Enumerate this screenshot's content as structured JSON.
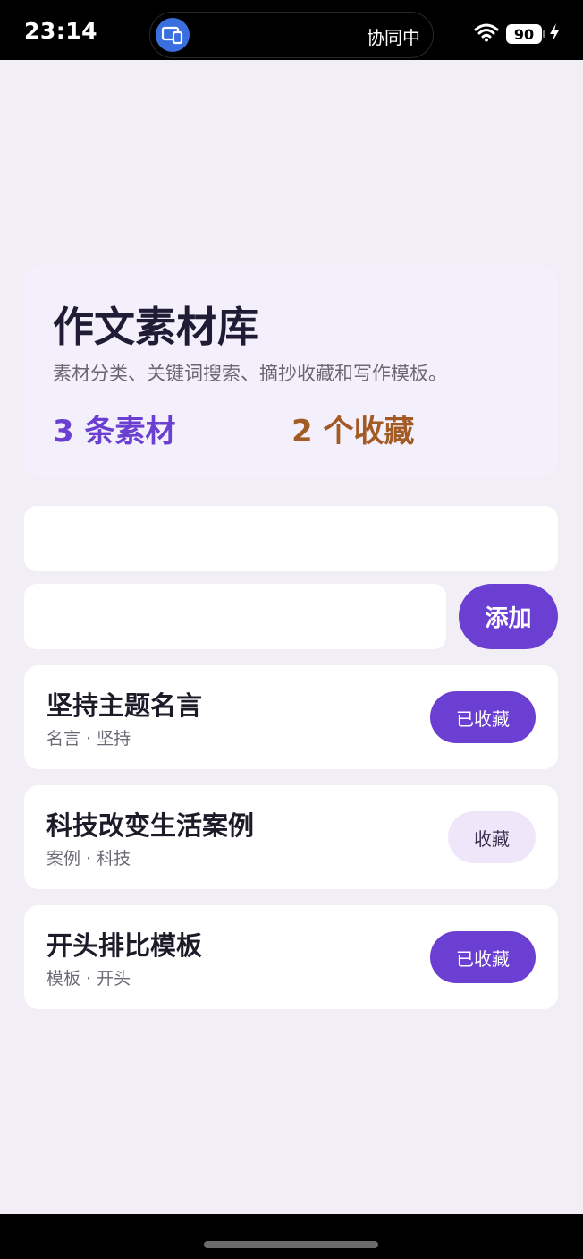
{
  "status_bar": {
    "time": "23:14",
    "pill_label": "协同中",
    "battery": "90",
    "app_icon": "screen-share-icon",
    "wifi_icon": "wifi-icon",
    "charging_icon": "bolt-icon"
  },
  "hero": {
    "title": "作文素材库",
    "subtitle": "素材分类、关键词搜索、摘抄收藏和写作模板。",
    "materials_count": "3 条素材",
    "favorites_count": "2 个收藏"
  },
  "search": {
    "placeholder": ""
  },
  "add": {
    "placeholder": "",
    "button_label": "添加"
  },
  "materials": [
    {
      "title": "坚持主题名言",
      "tags": "名言 · 坚持",
      "fav_label": "已收藏",
      "favorited": true
    },
    {
      "title": "科技改变生活案例",
      "tags": "案例 · 科技",
      "fav_label": "收藏",
      "favorited": false
    },
    {
      "title": "开头排比模板",
      "tags": "模板 · 开头",
      "fav_label": "已收藏",
      "favorited": true
    }
  ],
  "colors": {
    "accent": "#6b3fd2",
    "favorites_accent": "#a35b26",
    "background": "#f2eef6"
  }
}
